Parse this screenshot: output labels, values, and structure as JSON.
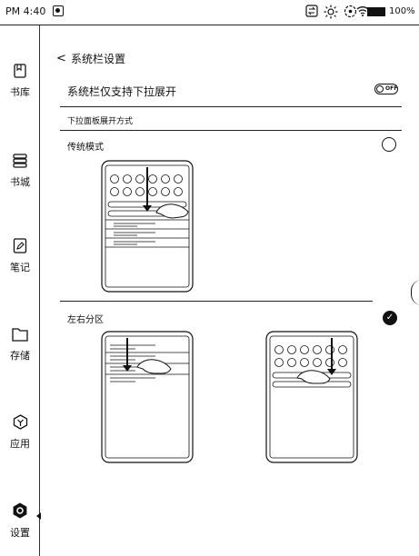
{
  "status_bar": {
    "time": "PM 4:40",
    "battery_percent": "100%",
    "icons": [
      "app-indicator-icon",
      "sync-icon",
      "brightness-icon",
      "eye-care-icon",
      "wifi-icon",
      "battery-icon"
    ]
  },
  "sidebar": {
    "items": [
      {
        "label": "书库",
        "icon": "library-icon"
      },
      {
        "label": "书城",
        "icon": "bookstore-icon"
      },
      {
        "label": "笔记",
        "icon": "notes-icon"
      },
      {
        "label": "存储",
        "icon": "storage-icon"
      },
      {
        "label": "应用",
        "icon": "apps-icon"
      },
      {
        "label": "设置",
        "icon": "settings-icon",
        "selected": true
      }
    ]
  },
  "page": {
    "title": "系统栏设置",
    "pulldown_only_label": "系统栏仅支持下拉展开",
    "toggle_text": "OFF",
    "section_header": "下拉面板展开方式",
    "modes": [
      {
        "label": "传统模式",
        "selected": false
      },
      {
        "label": "左右分区",
        "selected": true
      }
    ]
  }
}
